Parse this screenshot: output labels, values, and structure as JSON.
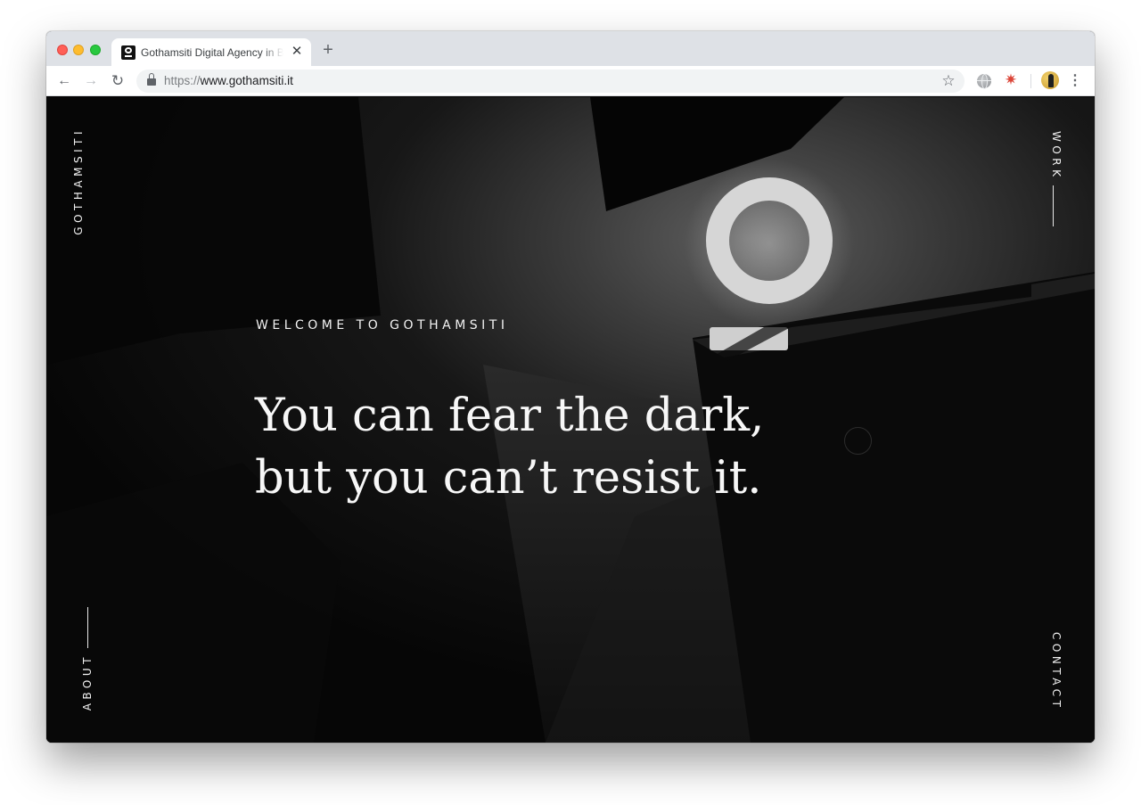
{
  "browser": {
    "tab": {
      "title": "Gothamsiti Digital Agency in Brescia",
      "close_glyph": "✕",
      "favicon": "gothamsiti-logo-icon"
    },
    "new_tab_glyph": "+",
    "nav": {
      "back_glyph": "←",
      "forward_glyph": "→",
      "reload_glyph": "↻"
    },
    "address": {
      "scheme": "https://",
      "host": "www.gothamsiti.it"
    },
    "bookmark_glyph": "☆",
    "extensions": [
      "globe-extension-icon",
      "star-extension-icon"
    ],
    "menu_glyph": "⋮",
    "colors": {
      "tabstrip": "#dee1e6",
      "close": "#ff5f57",
      "minimize": "#febc2e",
      "zoom": "#28c840"
    }
  },
  "site": {
    "brand": "GOTHAMSITI",
    "nav": {
      "work": "WORK",
      "about": "ABOUT",
      "contact": "CONTACT"
    },
    "hero": {
      "eyebrow": "WELCOME TO GOTHAMSITI",
      "line1": "You can fear the dark,",
      "line2": "but you can’t resist it."
    },
    "colors": {
      "background": "#030303",
      "text": "#f7f7f7"
    }
  }
}
